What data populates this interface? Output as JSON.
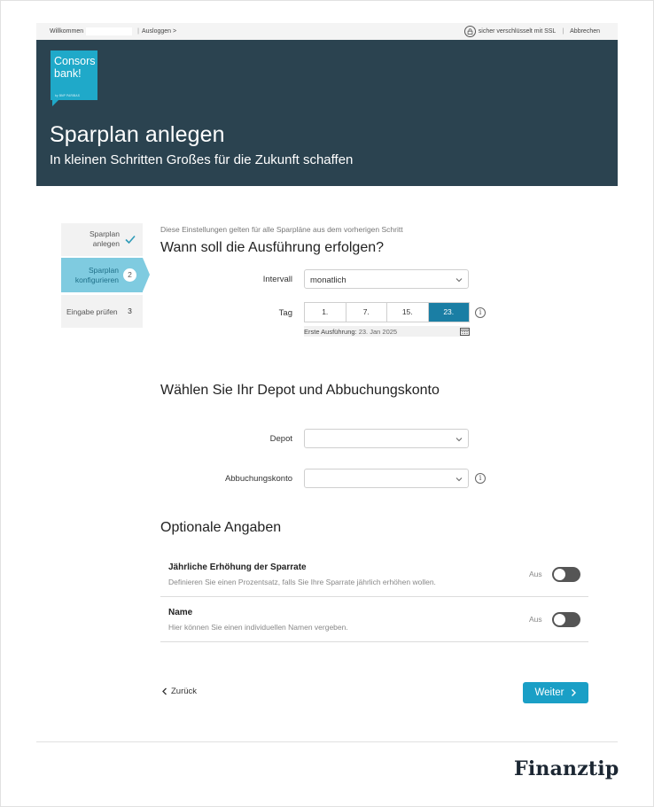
{
  "topbar": {
    "welcome": "Willkommen",
    "logout": "Ausloggen >",
    "ssl": "sicher verschlüsselt mit SSL",
    "cancel": "Abbrechen"
  },
  "hero": {
    "logo_line1": "Consors",
    "logo_line2": "bank!",
    "logo_tagline": "by BNP PARIBAS",
    "title": "Sparplan anlegen",
    "subtitle": "In kleinen Schritten Großes für die Zukunft schaffen"
  },
  "stepper": {
    "steps": [
      {
        "label_line1": "Sparplan",
        "label_line2": "anlegen",
        "state": "done"
      },
      {
        "label_line1": "Sparplan",
        "label_line2": "konfigurieren",
        "number": "2",
        "state": "active"
      },
      {
        "label": "Eingabe prüfen",
        "number": "3",
        "state": "pending"
      }
    ]
  },
  "execution": {
    "note": "Diese Einstellungen gelten für alle Sparpläne aus dem vorherigen Schritt",
    "heading": "Wann soll die Ausführung erfolgen?",
    "interval_label": "Intervall",
    "interval_value": "monatlich",
    "day_label": "Tag",
    "days": [
      "1.",
      "7.",
      "15.",
      "23."
    ],
    "selected_day": "23.",
    "first_exec_label": "Erste Ausführung:",
    "first_exec_value": "23. Jan 2025"
  },
  "depot": {
    "heading": "Wählen Sie Ihr Depot und Abbuchungskonto",
    "depot_label": "Depot",
    "depot_value": "",
    "account_label": "Abbuchungskonto",
    "account_value": ""
  },
  "optional": {
    "heading": "Optionale Angaben",
    "rows": [
      {
        "title": "Jährliche Erhöhung der Sparrate",
        "desc": "Definieren Sie einen Prozentsatz, falls Sie Ihre Sparrate jährlich erhöhen wollen.",
        "state": "Aus"
      },
      {
        "title": "Name",
        "desc": "Hier können Sie einen individuellen Namen vergeben.",
        "state": "Aus"
      }
    ]
  },
  "nav": {
    "back": "Zurück",
    "next": "Weiter"
  },
  "footer": {
    "brand": "Finanztip"
  },
  "colors": {
    "hero_bg": "#2b4350",
    "logo": "#1fa9c9",
    "step_active": "#7fcbe0",
    "day_active": "#1a7ea4",
    "button": "#1a9fc6"
  }
}
